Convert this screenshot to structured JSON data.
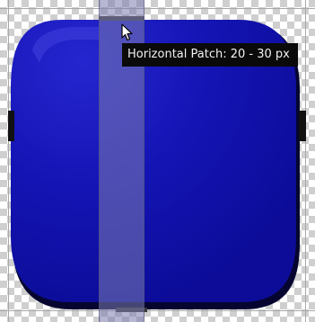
{
  "editor": {
    "tooltip_text": "Horizontal Patch: 20 - 30 px",
    "colors": {
      "fill": "#1414b4",
      "fill_dark": "#0a0a8c",
      "patch_overlay": "#7c7cb0",
      "marker": "#111111",
      "checker_light": "#ffffff",
      "checker_dark": "#cfcfcf"
    },
    "icons": {
      "cursor": "arrow-pointer-icon"
    }
  }
}
